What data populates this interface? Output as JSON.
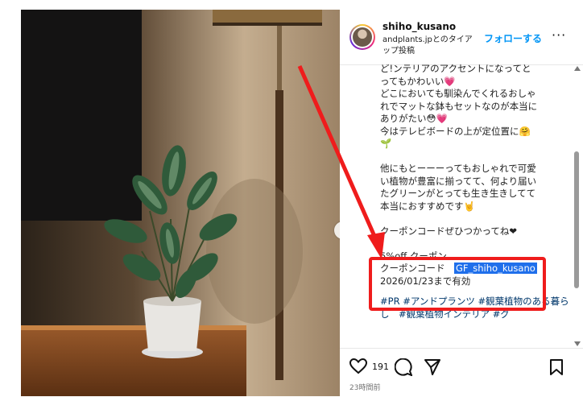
{
  "post": {
    "username": "shiho_kusano",
    "collab_line": "andplants.jpとのタイアップ投稿",
    "follow_label": "フォローする",
    "more_label": "···"
  },
  "caption": {
    "lines_top": [
      "ど!ンテリアのアクセントになってと",
      "ってもかわいい💗",
      "どこにおいても馴染んでくれるおしゃ",
      "れでマットな鉢もセットなのが本当に",
      "ありがたい😳💗",
      "今はテレビボードの上が定位置に🤗",
      "🌱"
    ],
    "lines_mid": [
      "他にもとーーーってもおしゃれで可愛",
      "い植物が豊富に揃ってて、何より届い",
      "たグリーンがとっても生き生きしてて",
      "本当におすすめです🤘"
    ],
    "coupon_intro": "クーポンコードぜひつかってね❤",
    "coupon_line1": "5%off クーポン",
    "coupon_code_label": "クーポンコード",
    "coupon_code": "GF_shiho_kusano",
    "coupon_expiry": "2026/01/23まで有効",
    "hashtags": "#PR #アンドプランツ #観葉植物のある暮らし　#観葉植物インテリア #グ"
  },
  "actions": {
    "likes": "191",
    "timestamp": "23時間前"
  },
  "icons": {
    "like": "heart-icon",
    "comment": "comment-icon",
    "share": "share-icon",
    "save": "bookmark-icon",
    "next": "chevron-right-icon"
  },
  "colors": {
    "link": "#0095f6",
    "hashtag": "#00376b",
    "annotation": "#ef1c1c",
    "highlight": "#1f6feb"
  }
}
